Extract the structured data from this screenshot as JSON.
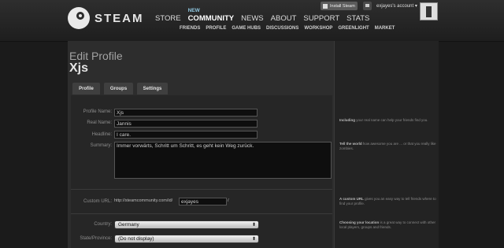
{
  "header": {
    "logo_text": "STEAM",
    "nav": [
      {
        "label": "STORE"
      },
      {
        "label": "COMMUNITY",
        "tag": "NEW"
      },
      {
        "label": "NEWS"
      },
      {
        "label": "ABOUT"
      },
      {
        "label": "SUPPORT"
      },
      {
        "label": "STATS"
      }
    ],
    "subnav": [
      "FRIENDS",
      "PROFILE",
      "GAME HUBS",
      "DISCUSSIONS",
      "WORKSHOP",
      "GREENLIGHT",
      "MARKET"
    ],
    "install_label": "Install Steam",
    "account_label": "exjayes's account ▾"
  },
  "page": {
    "title": "Edit Profile",
    "profile_name": "Xjs",
    "tabs": [
      "Profile",
      "Groups",
      "Settings"
    ]
  },
  "form": {
    "profile_name": {
      "label": "Profile Name:",
      "value": "Xjs"
    },
    "real_name": {
      "label": "Real Name:",
      "value": "Jannis"
    },
    "headline": {
      "label": "Headline:",
      "value": "I care."
    },
    "summary": {
      "label": "Summary:",
      "value": "Immer vorwärts, Schritt um Schritt, es geht kein Weg zurück."
    },
    "custom_url": {
      "label": "Custom URL:",
      "prefix": "http://steamcommunity.com/id/",
      "value": "exjayes",
      "suffix": "/"
    },
    "country": {
      "label": "Country:",
      "value": "Germany"
    },
    "state": {
      "label": "State/Province:",
      "value": "(Do not display)"
    }
  },
  "tips": [
    {
      "bold": "Including",
      "text": " your real name can help your friends find you."
    },
    {
      "bold": "Tell the world",
      "text": " how awesome you are ... or that you really like zombies."
    },
    {
      "bold": "A custom URL",
      "text": " gives you an easy way to tell friends where to find your profile."
    },
    {
      "bold": "Choosing your location",
      "text": " is a great way to connect with other local players, groups and friends."
    }
  ]
}
